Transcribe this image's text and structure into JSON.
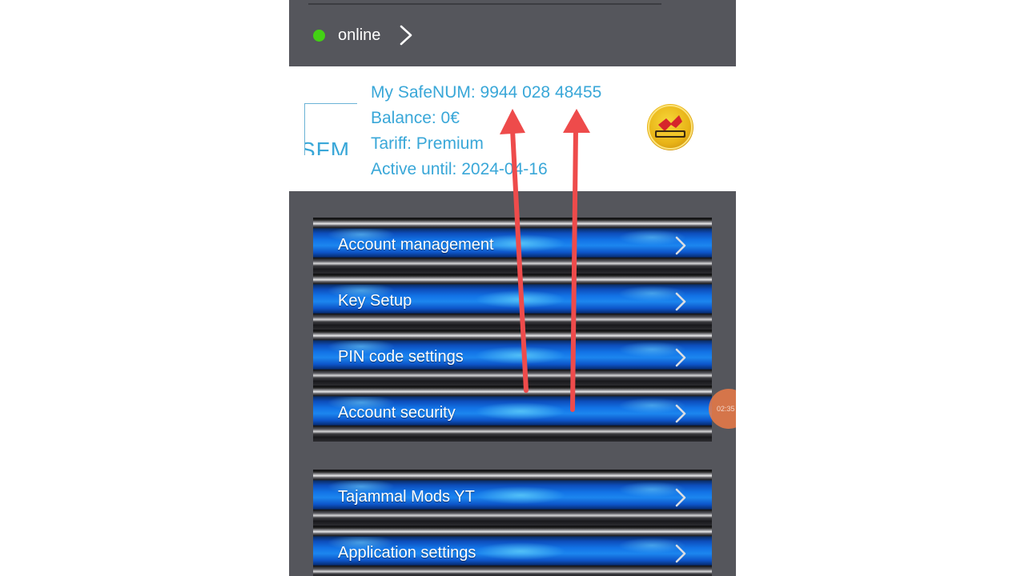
{
  "status": {
    "label": "online",
    "color": "#43d114"
  },
  "account": {
    "logo_text": "SFM",
    "safenum_label": "My SafeNUM: 9944 028 48455",
    "balance_label": "Balance: 0€",
    "tariff_label": "Tariff: Premium",
    "active_until_label": "Active until: 2024-04-16"
  },
  "menu_primary": [
    {
      "label": "Account management"
    },
    {
      "label": "Key Setup"
    },
    {
      "label": "PIN code settings"
    },
    {
      "label": "Account security"
    }
  ],
  "menu_secondary": [
    {
      "label": "Tajammal Mods YT"
    },
    {
      "label": "Application settings"
    }
  ],
  "floating_timer": "02:35",
  "colors": {
    "panel_background": "#55565c",
    "accent_text": "#39a7d8",
    "annotation_arrow": "#ee4b4b"
  }
}
